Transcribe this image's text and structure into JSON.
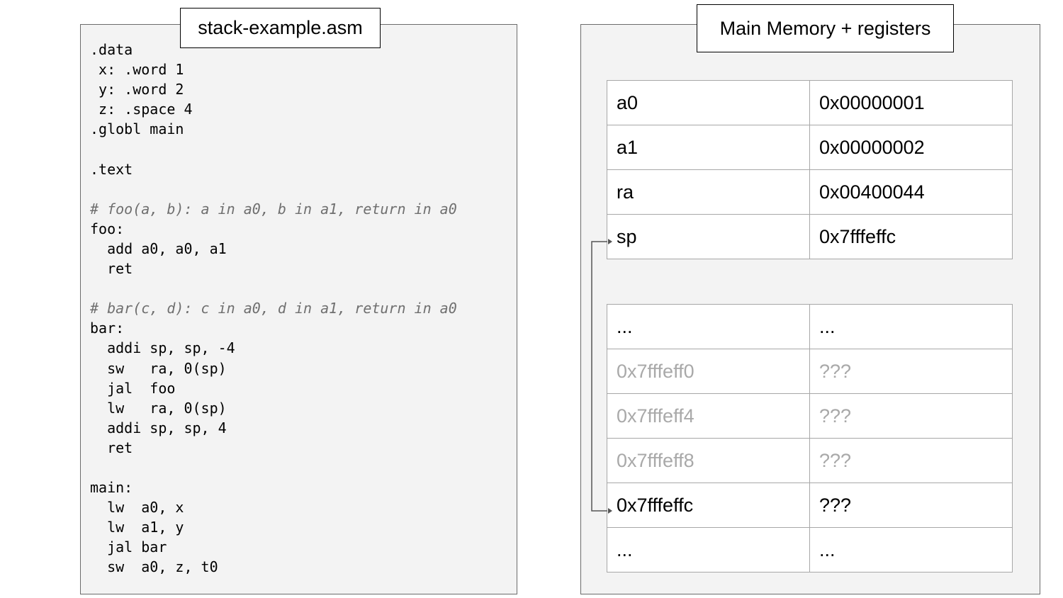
{
  "code_panel": {
    "title": "stack-example.asm",
    "lines": [
      {
        "text": ".data",
        "comment": false
      },
      {
        "text": " x: .word 1",
        "comment": false
      },
      {
        "text": " y: .word 2",
        "comment": false
      },
      {
        "text": " z: .space 4",
        "comment": false
      },
      {
        "text": ".globl main",
        "comment": false
      },
      {
        "text": "",
        "comment": false
      },
      {
        "text": ".text",
        "comment": false
      },
      {
        "text": "",
        "comment": false
      },
      {
        "text": "# foo(a, b): a in a0, b in a1, return in a0",
        "comment": true
      },
      {
        "text": "foo:",
        "comment": false
      },
      {
        "text": "  add a0, a0, a1",
        "comment": false
      },
      {
        "text": "  ret",
        "comment": false
      },
      {
        "text": "",
        "comment": false
      },
      {
        "text": "# bar(c, d): c in a0, d in a1, return in a0",
        "comment": true
      },
      {
        "text": "bar:",
        "comment": false
      },
      {
        "text": "  addi sp, sp, -4",
        "comment": false
      },
      {
        "text": "  sw   ra, 0(sp)",
        "comment": false
      },
      {
        "text": "  jal  foo",
        "comment": false
      },
      {
        "text": "  lw   ra, 0(sp)",
        "comment": false
      },
      {
        "text": "  addi sp, sp, 4",
        "comment": false
      },
      {
        "text": "  ret",
        "comment": false
      },
      {
        "text": "",
        "comment": false
      },
      {
        "text": "main:",
        "comment": false
      },
      {
        "text": "  lw  a0, x",
        "comment": false
      },
      {
        "text": "  lw  a1, y",
        "comment": false
      },
      {
        "text": "  jal bar",
        "comment": false
      },
      {
        "text": "  sw  a0, z, t0",
        "comment": false
      }
    ]
  },
  "memory_panel": {
    "title": "Main Memory + registers",
    "registers": [
      {
        "name": "a0",
        "value": "0x00000001"
      },
      {
        "name": "a1",
        "value": "0x00000002"
      },
      {
        "name": "ra",
        "value": "0x00400044"
      },
      {
        "name": "sp",
        "value": "0x7fffeffc"
      }
    ],
    "memory": [
      {
        "address": "...",
        "value": "...",
        "dimmed": false
      },
      {
        "address": "0x7fffeff0",
        "value": "???",
        "dimmed": true
      },
      {
        "address": "0x7fffeff4",
        "value": "???",
        "dimmed": true
      },
      {
        "address": "0x7fffeff8",
        "value": "???",
        "dimmed": true
      },
      {
        "address": "0x7fffeffc",
        "value": "???",
        "dimmed": false
      },
      {
        "address": "...",
        "value": "...",
        "dimmed": false
      }
    ]
  },
  "colors": {
    "panel_bg": "#f3f3f3",
    "dimmed_text": "#a9a9a9",
    "comment_text": "#6f6f6f",
    "arrow": "#555555"
  }
}
